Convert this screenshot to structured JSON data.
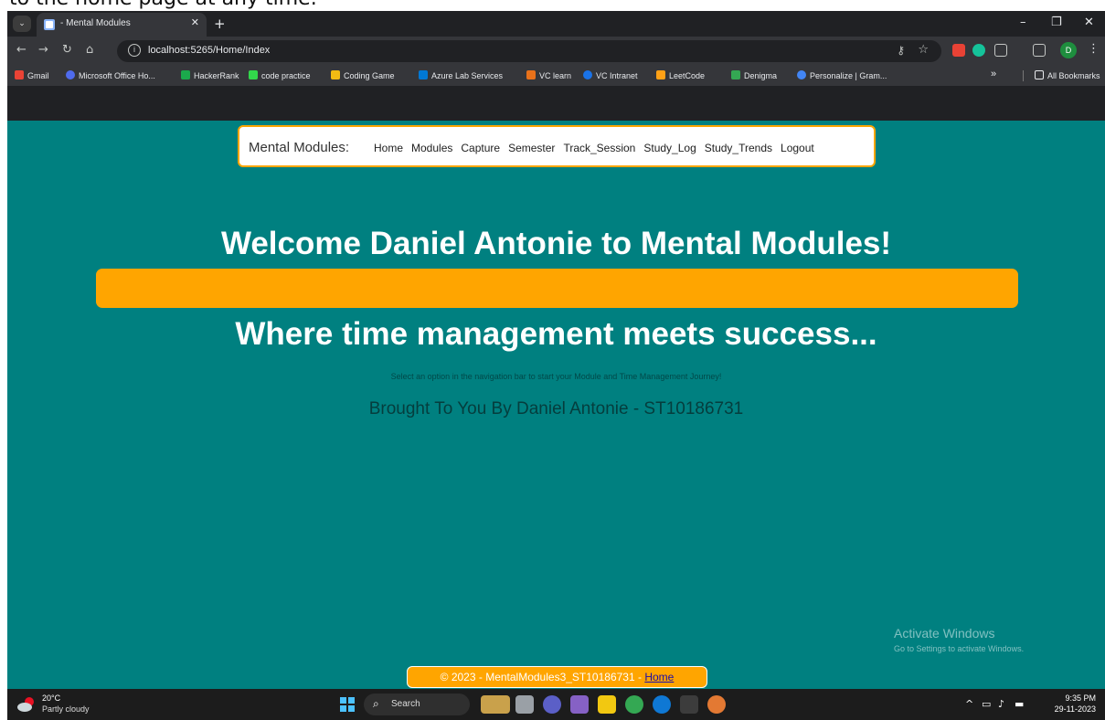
{
  "doc_text": "to the home page at any time.",
  "browser": {
    "tab_title": "- Mental Modules",
    "url": "localhost:5265/Home/Index",
    "profile_initial": "D",
    "bookmarks": [
      {
        "label": "Gmail",
        "color": "#ea4335"
      },
      {
        "label": "Microsoft Office Ho...",
        "color": "#4f6bed"
      },
      {
        "label": "HackerRank",
        "color": "#1ba94c"
      },
      {
        "label": "code practice",
        "color": "#32d74b"
      },
      {
        "label": "Coding Game",
        "color": "#f2bb13"
      },
      {
        "label": "Azure Lab Services",
        "color": "#0078d4"
      },
      {
        "label": "VC learn",
        "color": "#e8711a"
      },
      {
        "label": "VC Intranet",
        "color": "#1a73e8"
      },
      {
        "label": "LeetCode",
        "color": "#ffa116"
      },
      {
        "label": "Denigma",
        "color": "#34a853"
      },
      {
        "label": "Personalize | Gram...",
        "color": "#4285f4"
      }
    ],
    "bookmarks_overflow": "»",
    "all_bookmarks": "All Bookmarks"
  },
  "nav": {
    "brand": "Mental Modules:",
    "links": [
      "Home",
      "Modules",
      "Capture",
      "Semester",
      "Track_Session",
      "Study_Log",
      "Study_Trends",
      "Logout"
    ]
  },
  "hero": {
    "welcome": "Welcome Daniel Antonie to Mental Modules!",
    "tagline": "Where time management meets success...",
    "instruction": "Select an option in the navigation bar to start your Module and Time Management Journey!",
    "byline": "Brought To You By Daniel Antonie - ST10186731"
  },
  "watermark": {
    "title": "Activate Windows",
    "subtitle": "Go to Settings to activate Windows."
  },
  "footer": {
    "text": "© 2023 - MentalModules3_ST10186731 - ",
    "link": "Home"
  },
  "taskbar": {
    "temp": "20°C",
    "weather": "Partly cloudy",
    "search": "Search",
    "time": "9:35 PM",
    "date": "29-11-2023"
  },
  "colors": {
    "page_bg": "#008080",
    "accent": "#ffa500"
  }
}
